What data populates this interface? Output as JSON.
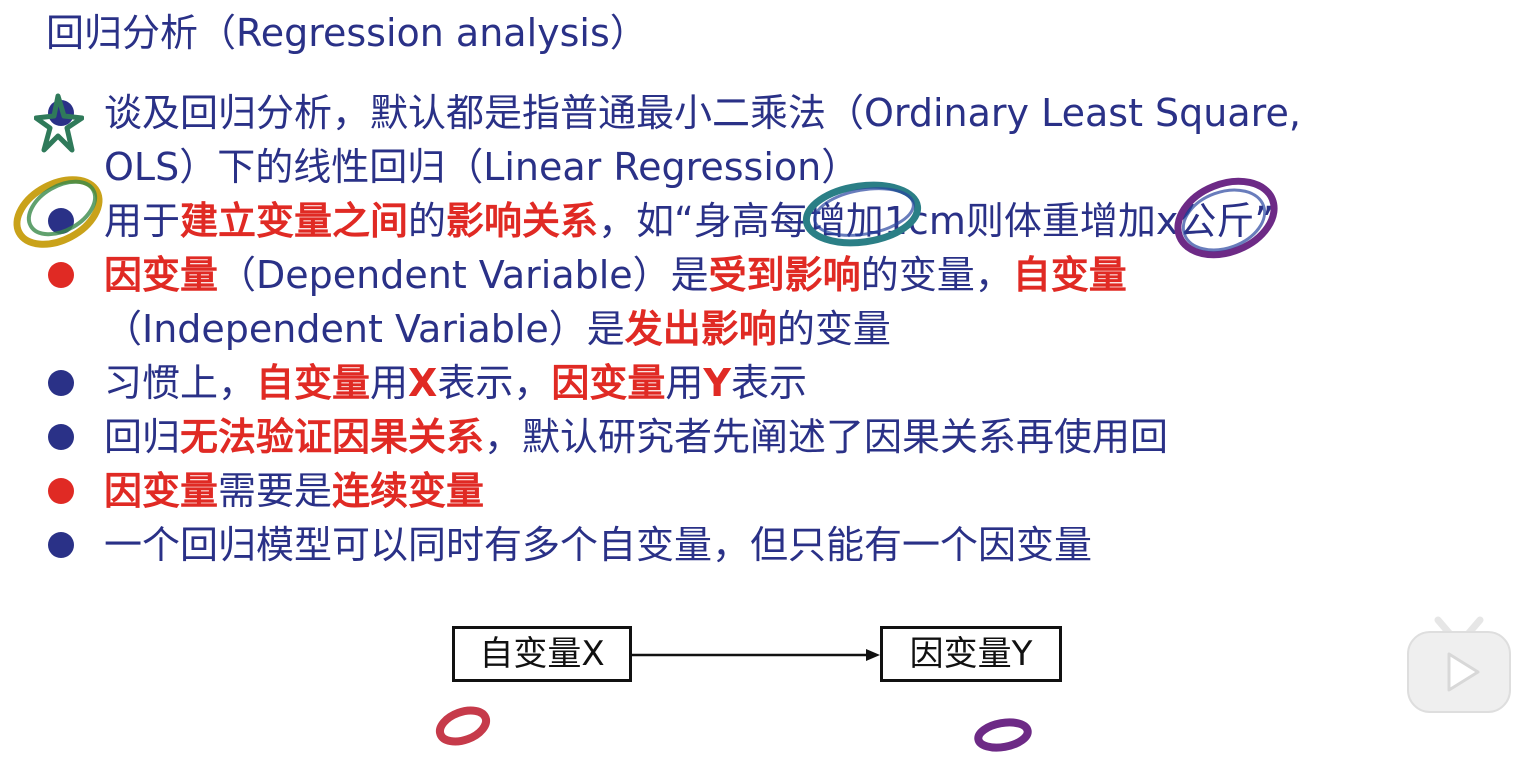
{
  "title": "回归分析（Regression analysis）",
  "bullets": [
    {
      "color": "blue",
      "lines": [
        [
          {
            "t": "谈及回归分析，默认都是指普通最小二乘法（Ordinary Least Square,",
            "hl": false
          }
        ],
        [
          {
            "t": "OLS）下的线性回归（Linear Regression）",
            "hl": false
          }
        ]
      ]
    },
    {
      "color": "blue",
      "lines": [
        [
          {
            "t": "用于",
            "hl": false
          },
          {
            "t": "建立变量之间",
            "hl": true
          },
          {
            "t": "的",
            "hl": false
          },
          {
            "t": "影响关系",
            "hl": true
          },
          {
            "t": "，如“身高每增加1cm则体重增加x公斤”",
            "hl": false
          }
        ]
      ]
    },
    {
      "color": "red",
      "lines": [
        [
          {
            "t": "因变量",
            "hl": true
          },
          {
            "t": "（Dependent Variable）是",
            "hl": false
          },
          {
            "t": "受到影响",
            "hl": true
          },
          {
            "t": "的变量，",
            "hl": false
          },
          {
            "t": "自变量",
            "hl": true
          }
        ],
        [
          {
            "t": "（Independent Variable）是",
            "hl": false
          },
          {
            "t": "发出影响",
            "hl": true
          },
          {
            "t": "的变量",
            "hl": false
          }
        ]
      ]
    },
    {
      "color": "blue",
      "lines": [
        [
          {
            "t": "习惯上，",
            "hl": false
          },
          {
            "t": "自变量",
            "hl": true
          },
          {
            "t": "用",
            "hl": false
          },
          {
            "t": "X",
            "hl": true
          },
          {
            "t": "表示，",
            "hl": false
          },
          {
            "t": "因变量",
            "hl": true
          },
          {
            "t": "用",
            "hl": false
          },
          {
            "t": "Y",
            "hl": true
          },
          {
            "t": "表示",
            "hl": false
          }
        ]
      ]
    },
    {
      "color": "blue",
      "lines": [
        [
          {
            "t": "回归",
            "hl": false
          },
          {
            "t": "无法验证因果关系",
            "hl": true
          },
          {
            "t": "，默认研究者先阐述了因果关系再使用回",
            "hl": false
          }
        ]
      ]
    },
    {
      "color": "red",
      "lines": [
        [
          {
            "t": "因变量",
            "hl": true
          },
          {
            "t": "需要是",
            "hl": false
          },
          {
            "t": "连续变量",
            "hl": true
          }
        ]
      ]
    },
    {
      "color": "blue",
      "lines": [
        [
          {
            "t": "一个回归模型可以同时有多个自变量，但只能有一个因变量",
            "hl": false
          }
        ]
      ]
    }
  ],
  "diagram": {
    "left_box": "自变量X",
    "right_box": "因变量Y"
  },
  "colors": {
    "text": "#2a3187",
    "highlight": "#e02a24",
    "box_border": "#111111"
  },
  "icons": {
    "play_badge": "bilibili-play-icon"
  }
}
